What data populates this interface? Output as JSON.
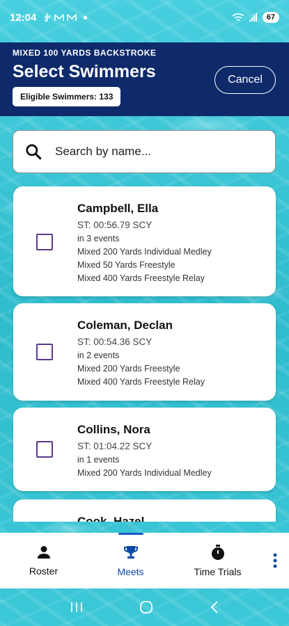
{
  "status": {
    "time": "12:04",
    "battery": "67"
  },
  "header": {
    "event_name": "MIXED 100 YARDS BACKSTROKE",
    "title": "Select Swimmers",
    "eligible_label": "Eligible Swimmers: 133",
    "cancel_label": "Cancel"
  },
  "search": {
    "placeholder": "Search by name..."
  },
  "swimmers": [
    {
      "name": "Campbell, Ella",
      "seed_time": "ST: 00:56.79 SCY",
      "event_count": "in 3 events",
      "events": [
        "Mixed 200 Yards Individual Medley",
        "Mixed 50 Yards Freestyle",
        "Mixed 400 Yards Freestyle Relay"
      ]
    },
    {
      "name": "Coleman, Declan",
      "seed_time": "ST: 00:54.36 SCY",
      "event_count": "in 2 events",
      "events": [
        "Mixed 200 Yards Freestyle",
        "Mixed 400 Yards Freestyle Relay"
      ]
    },
    {
      "name": "Collins, Nora",
      "seed_time": "ST: 01:04.22 SCY",
      "event_count": "in 1 events",
      "events": [
        "Mixed 200 Yards Individual Medley"
      ]
    },
    {
      "name": "Cook, Hazel",
      "seed_time": "",
      "event_count": "",
      "events": []
    }
  ],
  "nav": {
    "roster": "Roster",
    "meets": "Meets",
    "time_trials": "Time Trials"
  },
  "colors": {
    "header_bg": "#0e2a6b",
    "accent": "#1a5bc4",
    "checkbox": "#5a3a8c"
  }
}
